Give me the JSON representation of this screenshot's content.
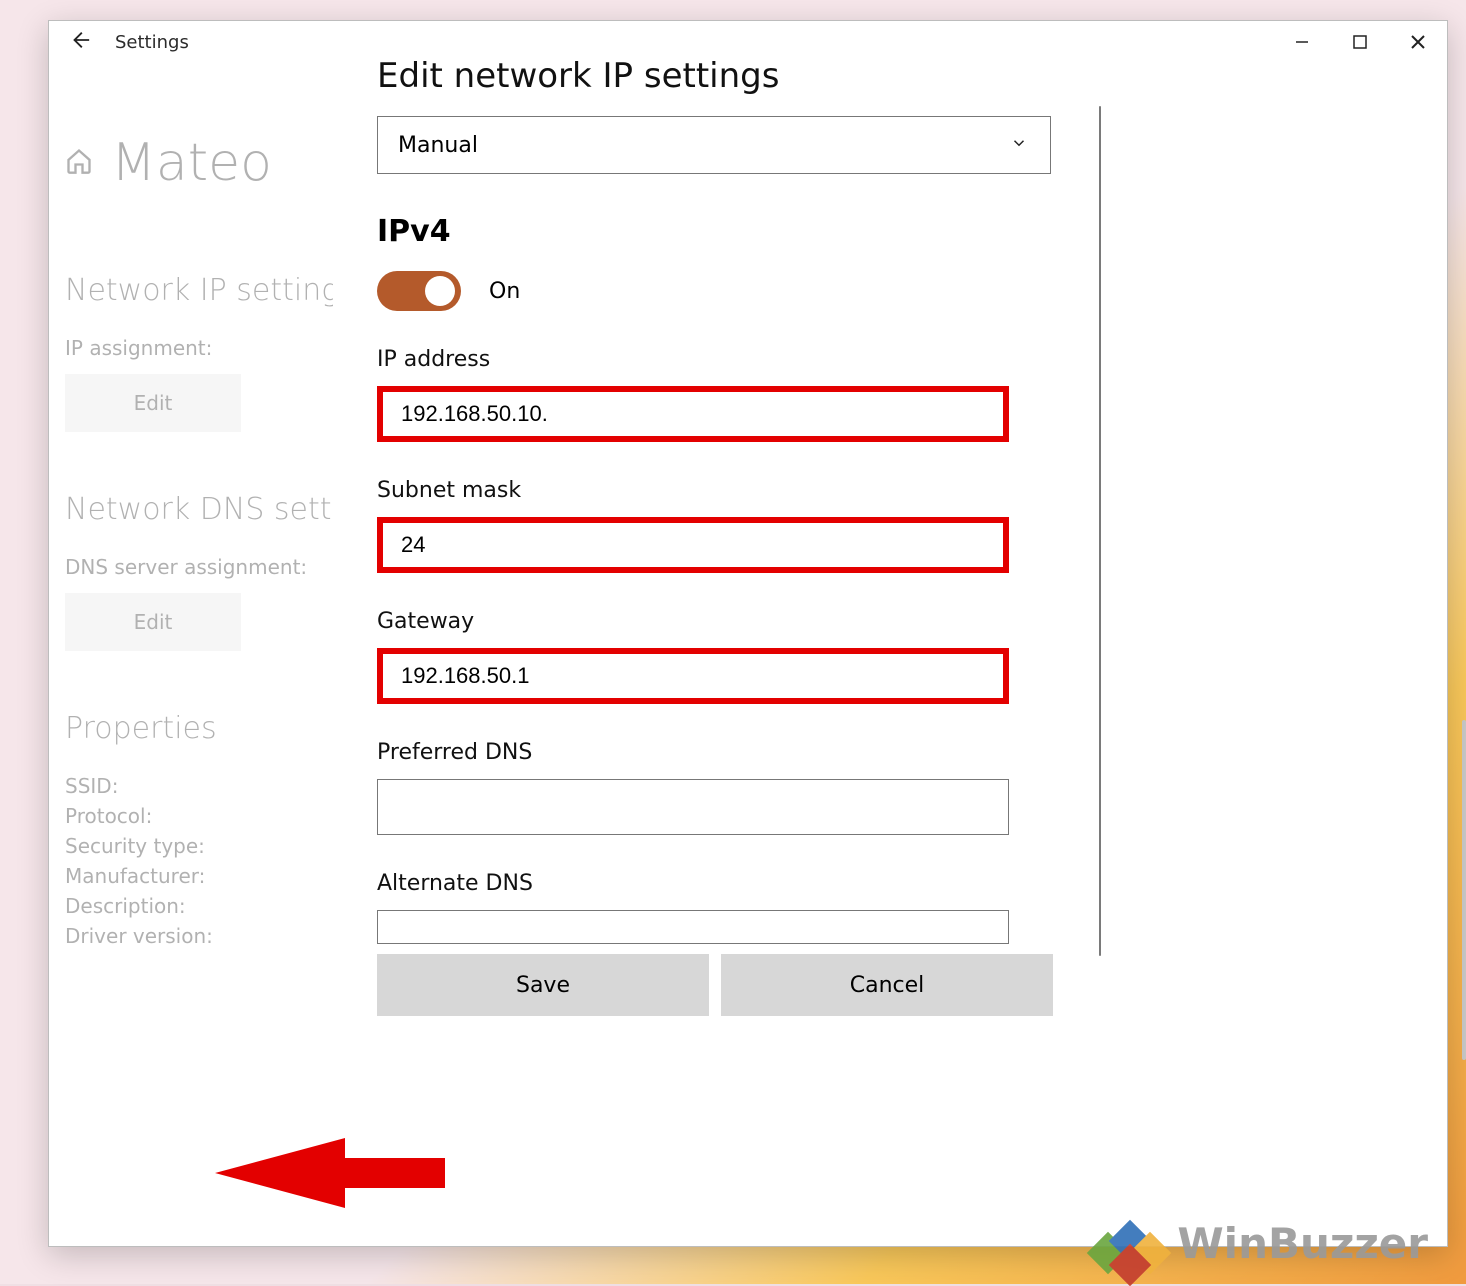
{
  "titlebar": {
    "app_label": "Settings"
  },
  "background": {
    "username": "Mateo",
    "section1_title": "Network IP settings",
    "ip_assignment_label": "IP assignment:",
    "edit_label": "Edit",
    "section2_title": "Network DNS settings",
    "dns_assignment_label": "DNS server assignment:",
    "section3_title": "Properties",
    "properties": [
      "SSID:",
      "Protocol:",
      "Security type:",
      "Manufacturer:",
      "Description:",
      "Driver version:"
    ]
  },
  "dialog": {
    "title": "Edit network IP settings",
    "mode_selected": "Manual",
    "ipv4_heading": "IPv4",
    "toggle_state": "On",
    "fields": {
      "ip_label": "IP address",
      "ip_value": "192.168.50.10.",
      "subnet_label": "Subnet mask",
      "subnet_value": "24",
      "gateway_label": "Gateway",
      "gateway_value": "192.168.50.1",
      "pref_dns_label": "Preferred DNS",
      "pref_dns_value": "",
      "alt_dns_label": "Alternate DNS",
      "alt_dns_value": ""
    },
    "save_label": "Save",
    "cancel_label": "Cancel"
  },
  "watermark": {
    "text": "WinBuzzer"
  }
}
